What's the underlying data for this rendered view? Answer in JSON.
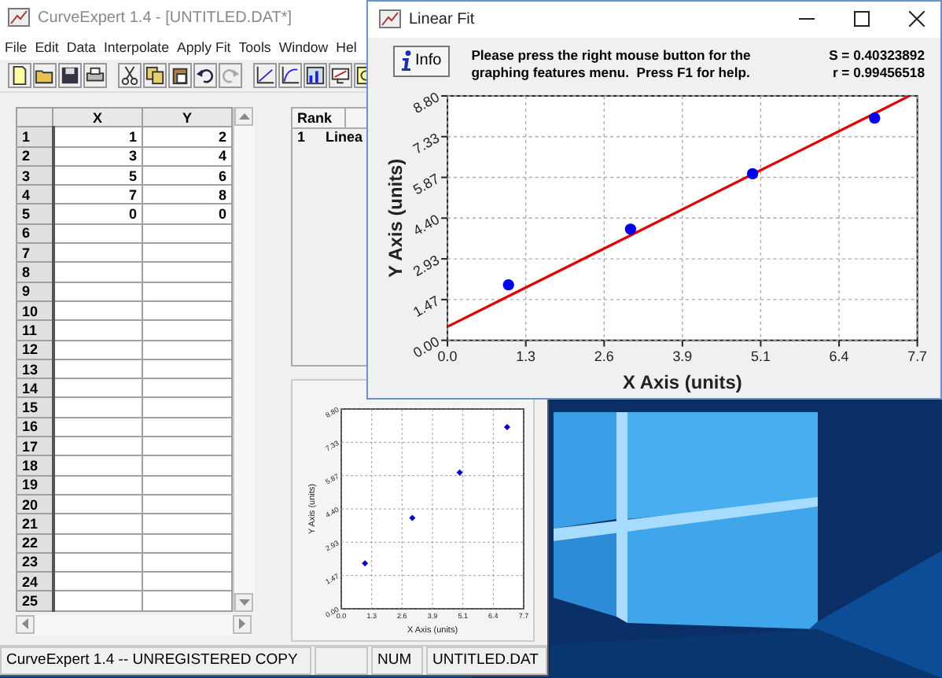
{
  "main_window": {
    "title": "CurveExpert 1.4 - [UNTITLED.DAT*]",
    "menu": [
      "File",
      "Edit",
      "Data",
      "Interpolate",
      "Apply Fit",
      "Tools",
      "Window",
      "Hel"
    ],
    "grid": {
      "columns": [
        "X",
        "Y"
      ],
      "rows": [
        {
          "label": "1",
          "cells": [
            "1",
            "2"
          ]
        },
        {
          "label": "2",
          "cells": [
            "3",
            "4"
          ]
        },
        {
          "label": "3",
          "cells": [
            "5",
            "6"
          ]
        },
        {
          "label": "4",
          "cells": [
            "7",
            "8"
          ]
        },
        {
          "label": "5",
          "cells": [
            "0",
            "0"
          ]
        },
        {
          "label": "6"
        },
        {
          "label": "7"
        },
        {
          "label": "8"
        },
        {
          "label": "9"
        },
        {
          "label": "10"
        },
        {
          "label": "11"
        },
        {
          "label": "12"
        },
        {
          "label": "13"
        },
        {
          "label": "14"
        },
        {
          "label": "15"
        },
        {
          "label": "16"
        },
        {
          "label": "17"
        },
        {
          "label": "18"
        },
        {
          "label": "19"
        },
        {
          "label": "20"
        },
        {
          "label": "21"
        },
        {
          "label": "22"
        },
        {
          "label": "23"
        },
        {
          "label": "24"
        },
        {
          "label": "25"
        }
      ]
    },
    "rank_panel": {
      "columns": [
        "Rank"
      ],
      "rows": [
        {
          "rank": "1",
          "name": "Linea"
        }
      ]
    },
    "preview": {
      "chart_data": {
        "type": "scatter",
        "xlabel": "X Axis (units)",
        "ylabel": "Y Axis (units)",
        "x": [
          1,
          3,
          5,
          7
        ],
        "grid": true,
        "series": [
          {
            "marker": "diamond",
            "color": "#0000cc",
            "values": [
              2,
              4,
              6,
              8
            ]
          }
        ],
        "xlim": [
          0,
          7.7
        ],
        "ylim": [
          0,
          8.8
        ],
        "xticks": [
          {
            "value": 0,
            "label": "0.0"
          },
          {
            "value": 1.283,
            "label": "1.3"
          },
          {
            "value": 2.567,
            "label": "2.6"
          },
          {
            "value": 3.85,
            "label": "3.9"
          },
          {
            "value": 5.133,
            "label": "5.1"
          },
          {
            "value": 6.417,
            "label": "6.4"
          },
          {
            "value": 7.7,
            "label": "7.7"
          }
        ],
        "yticks": [
          {
            "value": 0,
            "label": "0.00"
          },
          {
            "value": 1.467,
            "label": "1.47"
          },
          {
            "value": 2.933,
            "label": "2.93"
          },
          {
            "value": 4.4,
            "label": "4.40"
          },
          {
            "value": 5.867,
            "label": "5.87"
          },
          {
            "value": 7.333,
            "label": "7.33"
          },
          {
            "value": 8.8,
            "label": "8.80"
          }
        ]
      }
    },
    "status_bar": {
      "message": "CurveExpert 1.4 -- UNREGISTERED COPY",
      "indicator": "NUM",
      "file": "UNTITLED.DAT"
    }
  },
  "fit_window": {
    "title": "Linear Fit",
    "info_button": "Info",
    "message": "Please press the right mouse button for the graphing features menu.  Press F1 for help.",
    "stats": [
      "S = 0.40323892",
      "r = 0.99456518"
    ],
    "chart_data": {
      "type": "scatter",
      "xlabel": "X Axis (units)",
      "ylabel": "Y Axis (units)",
      "x": [
        0,
        1,
        3,
        5,
        7,
        7.57
      ],
      "grid": true,
      "series": [
        {
          "marker": "circle",
          "color": "#0000ee",
          "values": [
            null,
            2,
            4,
            6,
            8,
            null
          ]
        },
        {
          "type": "line",
          "color": "#e00000",
          "values": [
            0.49,
            1.59,
            3.78,
            5.98,
            8.17,
            8.8
          ]
        }
      ],
      "xlim": [
        0,
        7.7
      ],
      "ylim": [
        0,
        8.8
      ],
      "xticks": [
        {
          "value": 0,
          "label": "0.0"
        },
        {
          "value": 1.283,
          "label": "1.3"
        },
        {
          "value": 2.567,
          "label": "2.6"
        },
        {
          "value": 3.85,
          "label": "3.9"
        },
        {
          "value": 5.133,
          "label": "5.1"
        },
        {
          "value": 6.417,
          "label": "6.4"
        },
        {
          "value": 7.7,
          "label": "7.7"
        }
      ],
      "yticks": [
        {
          "value": 0,
          "label": "0.00"
        },
        {
          "value": 1.467,
          "label": "1.47"
        },
        {
          "value": 2.933,
          "label": "2.93"
        },
        {
          "value": 4.4,
          "label": "4.40"
        },
        {
          "value": 5.867,
          "label": "5.87"
        },
        {
          "value": 7.333,
          "label": "7.33"
        },
        {
          "value": 8.8,
          "label": "8.80"
        }
      ]
    }
  }
}
